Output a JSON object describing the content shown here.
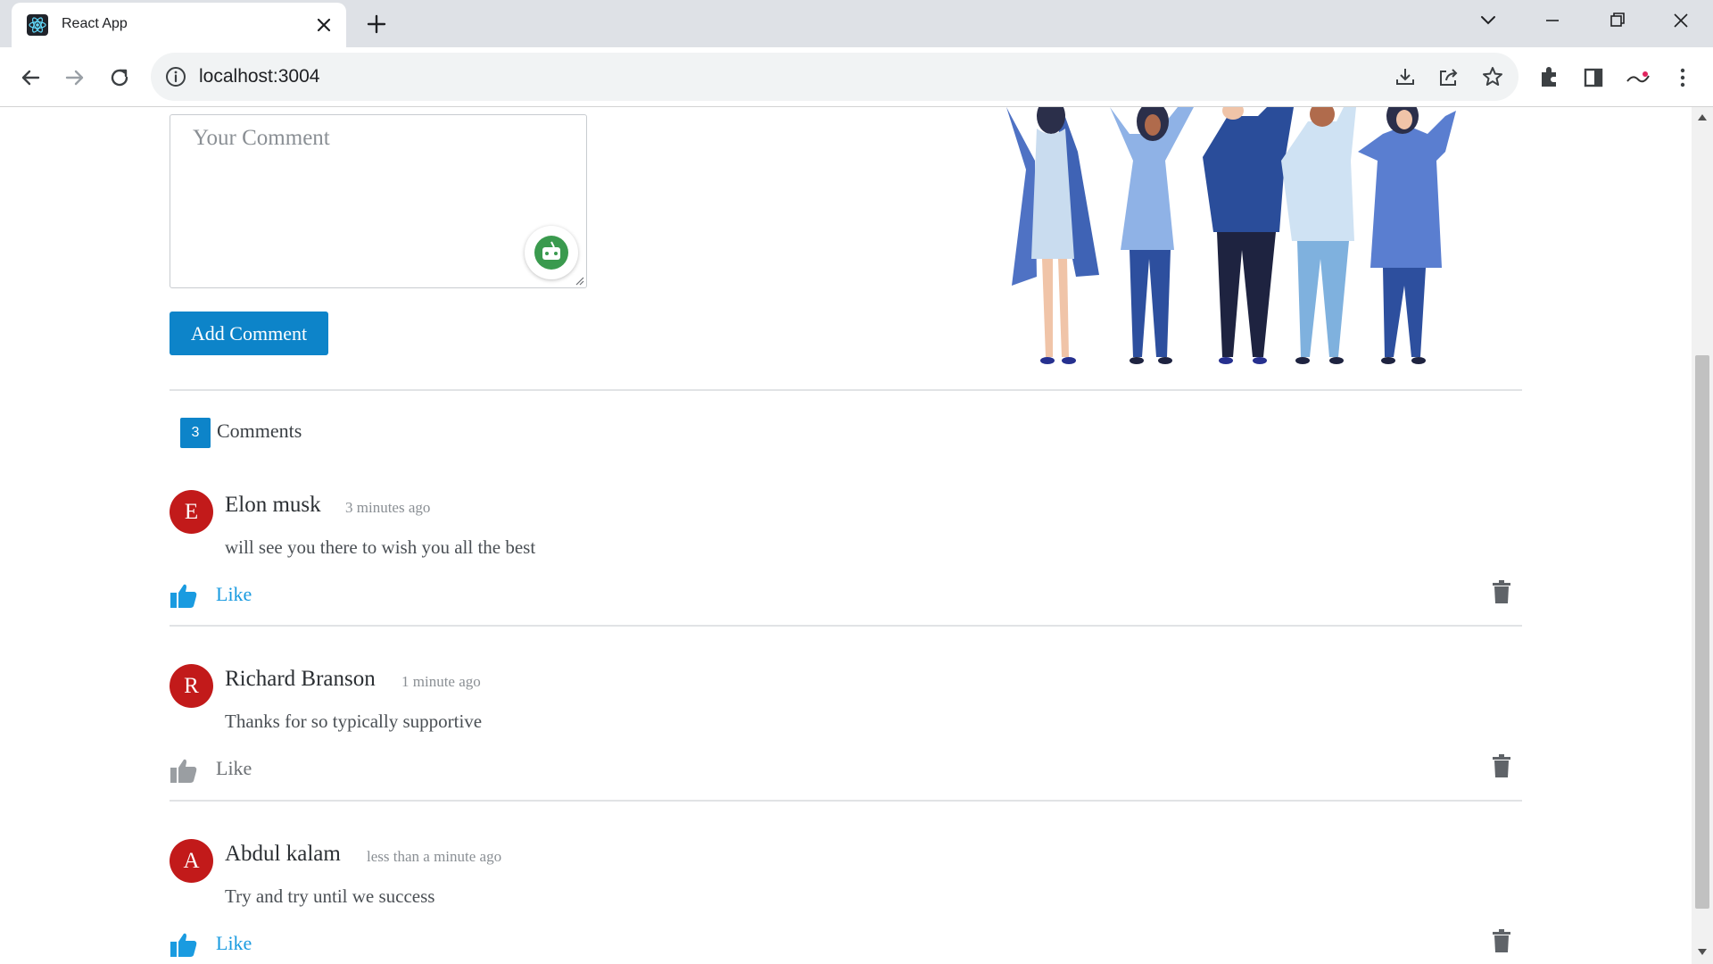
{
  "browser": {
    "tab_title": "React App",
    "url": "localhost:3004"
  },
  "form": {
    "placeholder": "Your Comment",
    "submit_label": "Add Comment"
  },
  "comments_header": {
    "count": "3",
    "label": "Comments"
  },
  "comments": [
    {
      "initial": "E",
      "author": "Elon musk",
      "time": "3 minutes ago",
      "text": "will see you there to wish you all the best",
      "like_label": "Like",
      "liked": true
    },
    {
      "initial": "R",
      "author": "Richard Branson",
      "time": "1 minute ago",
      "text": "Thanks for so typically supportive",
      "like_label": "Like",
      "liked": false
    },
    {
      "initial": "A",
      "author": "Abdul kalam",
      "time": "less than a minute ago",
      "text": "Try and try until we success",
      "like_label": "Like",
      "liked": true
    }
  ],
  "colors": {
    "accent": "#0d84c9",
    "avatar": "#c21a1a",
    "like_active": "#1a9be0",
    "like_inactive": "#9a9ea2",
    "trash": "#5f6368"
  }
}
